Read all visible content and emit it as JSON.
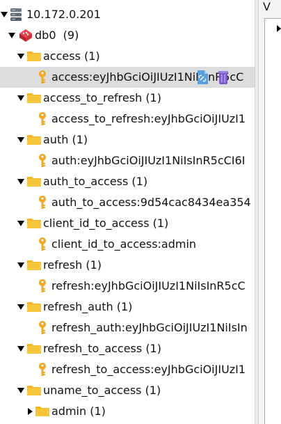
{
  "tree": {
    "server": {
      "label": "10.172.0.201",
      "icon": "server-icon"
    },
    "database": {
      "name": "db0",
      "count": "(9)",
      "icon": "database-icon"
    },
    "folders": [
      {
        "label": "access (1)",
        "keys": [
          "access:eyJhbGciOiJIUzI1NiIsInR5cC"
        ],
        "expanded": true
      },
      {
        "label": "access_to_refresh (1)",
        "keys": [
          "access_to_refresh:eyJhbGciOiJIUzI1"
        ],
        "expanded": true
      },
      {
        "label": "auth (1)",
        "keys": [
          "auth:eyJhbGciOiJIUzI1NiIsInR5cCI6I"
        ],
        "expanded": true
      },
      {
        "label": "auth_to_access (1)",
        "keys": [
          "auth_to_access:9d54cac8434ea354"
        ],
        "expanded": true
      },
      {
        "label": "client_id_to_access (1)",
        "keys": [
          "client_id_to_access:admin"
        ],
        "expanded": true
      },
      {
        "label": "refresh (1)",
        "keys": [
          "refresh:eyJhbGciOiJIUzI1NiIsInR5cC"
        ],
        "expanded": true
      },
      {
        "label": "refresh_auth (1)",
        "keys": [
          "refresh_auth:eyJhbGciOiJIUzI1NiIsIn"
        ],
        "expanded": true
      },
      {
        "label": "refresh_to_access (1)",
        "keys": [
          "refresh_to_access:eyJhbGciOiJIUzI1"
        ],
        "expanded": true
      },
      {
        "label": "uname_to_access (1)",
        "subfolders": [
          "admin (1)"
        ],
        "expanded": true
      }
    ]
  },
  "right_panel": {
    "header": "V"
  },
  "colors": {
    "folder": "#f3b51f",
    "key": "#f0a81c",
    "database": "#d8303c",
    "server": "#5f6b78",
    "selected_row": "#dcdcdc"
  }
}
